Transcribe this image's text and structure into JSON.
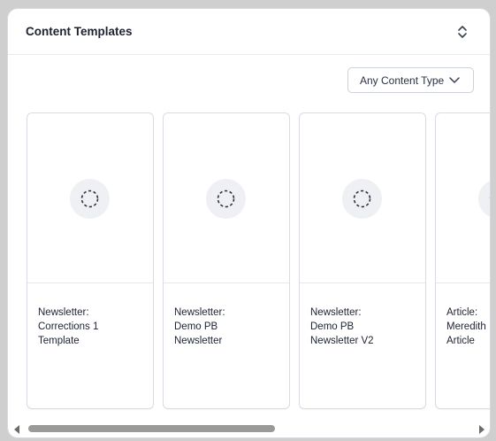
{
  "panel": {
    "title": "Content Templates",
    "collapse_icon": "chevron-up-down-icon"
  },
  "filter": {
    "selected": "Any Content Type",
    "icon": "chevron-down-icon"
  },
  "cards": [
    {
      "label": "Newsletter:\nCorrections 1\nTemplate",
      "thumb_icon": "loading-spinner-icon"
    },
    {
      "label": "Newsletter:\nDemo PB\nNewsletter",
      "thumb_icon": "loading-spinner-icon"
    },
    {
      "label": "Newsletter:\nDemo PB\nNewsletter V2",
      "thumb_icon": "loading-spinner-icon"
    },
    {
      "label": "Article:\nMeredith\nArticle",
      "thumb_icon": "loading-spinner-icon"
    }
  ],
  "colors": {
    "panel_border": "#d7d9de",
    "thumb_circle": "#eef0f4",
    "scroll_thumb": "#9a9a9a",
    "text": "#1d2330"
  }
}
